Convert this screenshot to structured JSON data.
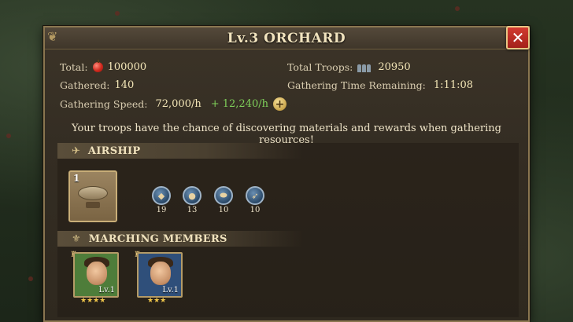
{
  "title": "Lv.3 ORCHARD",
  "close_icon": "close-icon",
  "stats": {
    "total_label": "Total:",
    "total_value": "100000",
    "gathered_label": "Gathered:",
    "gathered_value": "140",
    "speed_label": "Gathering Speed:",
    "speed_value": "72,000/h",
    "speed_bonus": "+ 12,240/h",
    "troops_label": "Total Troops:",
    "troops_value": "20950",
    "time_label": "Gathering Time Remaining:",
    "time_value": "1:11:08"
  },
  "note": "Your troops have the chance of discovering materials and rewards when gathering resources!",
  "airship_section": {
    "title": "AIRSHIP",
    "card_count": "1",
    "units": [
      {
        "icon": "cannon-unit-icon",
        "count": "19"
      },
      {
        "icon": "bomb-unit-icon",
        "count": "13"
      },
      {
        "icon": "airship-unit-icon",
        "count": "10"
      },
      {
        "icon": "rocket-unit-icon",
        "count": "10"
      }
    ]
  },
  "marching_section": {
    "title": "MARCHING MEMBERS",
    "members": [
      {
        "level": "Lv.1",
        "stars": "★★★★",
        "bg": "#4e7d3a"
      },
      {
        "level": "Lv.1",
        "stars": "★★★",
        "bg": "#2f4f7a"
      }
    ]
  },
  "colors": {
    "accent_gold": "#f3e6b7",
    "bonus_green": "#7fd05a",
    "close_red": "#c62c23"
  }
}
